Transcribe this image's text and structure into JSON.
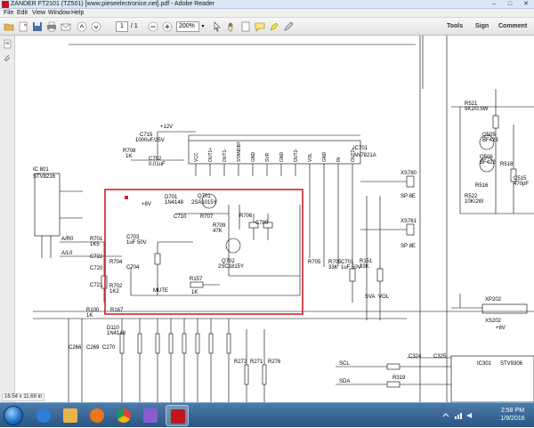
{
  "window": {
    "title": "ZANDER FT2101 (TZ501) [www.pieseelectronice.net].pdf - Adobe Reader",
    "minimize_icon": "minimize-icon",
    "maximize_icon": "maximize-icon",
    "close_icon": "close-icon"
  },
  "menu": [
    "File",
    "Edit",
    "View",
    "Window",
    "Help"
  ],
  "toolbar": {
    "page_current": "1",
    "page_total": "/ 1",
    "zoom": "200%",
    "tools": "Tools",
    "sign": "Sign",
    "comment": "Comment"
  },
  "schematic": {
    "labels": {
      "ic801": "IC 801",
      "stv8216": "STV8216",
      "ic701": "IC701",
      "an7821a": "AN7821A",
      "plus12v": "+12V",
      "c715": "C715",
      "c715v": "1000uF/25V",
      "r708": "R708",
      "r708v": "1K",
      "c702": "C702",
      "c702v": "0.01uF",
      "q701": "Q701",
      "q701v": "2SA1015Y",
      "d701": "D701",
      "d701v": "1N4148",
      "plus8v": "+8V",
      "c710": "C710",
      "r707": "R707",
      "r706": "R706",
      "c709": "C709",
      "q702": "Q702",
      "q702v": "2SC1815Y",
      "r709": "R709",
      "r709v": "47K",
      "c703": "C703",
      "c703v": "1uF 50V",
      "c704": "C704",
      "r704": "R704",
      "r705": "R705",
      "r701": "R701",
      "r701v": "1K5",
      "c722": "C722",
      "c720": "C720",
      "c721": "C721",
      "r702": "R702",
      "r702v": "1K2",
      "mute": "MUTE",
      "r157": "R157",
      "r157v": "1K",
      "r705b": "R705",
      "r705bv": "33K",
      "c701": "C701",
      "c701v": "1uF 50V",
      "r151": "R151",
      "r151v": "33K",
      "sva": "SVA",
      "vol": "VOL",
      "xs760": "XS760",
      "xs761": "XS761",
      "sp8e": "SP 8E",
      "sp8e2": "SP 8E",
      "r521": "R521",
      "r521v": "5K2/0.5W",
      "q505": "Q505",
      "q505v": "BF423",
      "q506": "Q506",
      "q506v": "BF422",
      "r516": "R516",
      "r518": "R518",
      "c515": "C515",
      "c515v": "470pF",
      "r522": "R522",
      "r522v": "10K/2W",
      "xs202": "XS202",
      "xp202": "XP202",
      "plus8v2": "+8V",
      "r100": "R100",
      "r100v": "1K",
      "r167": "R167",
      "d110": "D110",
      "d110v": "1N4148",
      "c266": "C266",
      "c269": "C269",
      "c270": "C270",
      "ic301": "IC301",
      "stv9306": "STV9306",
      "scl": "SCL",
      "sda": "SDA",
      "c324": "C324",
      "c325": "C325",
      "r319": "R319",
      "r271": "R271",
      "r272": "R272",
      "r276": "R276",
      "a_l0": "A/L0",
      "a_r0": "A/R0",
      "pin_labels": [
        "VCC",
        "OUT1+",
        "OUT1-",
        "STANDBY",
        "GND",
        "SVR",
        "GND",
        "OUT2-",
        "VOL",
        "GND",
        "IN",
        "OUT2+"
      ]
    }
  },
  "status": {
    "page_size": "16.54 x 11.69 in"
  },
  "taskbar": {
    "time": "2:58 PM",
    "date": "1/9/2016",
    "apps": [
      {
        "name": "internet-explorer-icon",
        "color": "#2f7fd9"
      },
      {
        "name": "file-explorer-icon",
        "color": "#e8b547"
      },
      {
        "name": "media-player-icon",
        "color": "#e8761c"
      },
      {
        "name": "chrome-icon",
        "color": "#3aa757"
      },
      {
        "name": "paint-icon",
        "color": "#8a5bd1"
      },
      {
        "name": "remote-icon",
        "color": "#2aa0d6"
      },
      {
        "name": "adobe-reader-icon",
        "color": "#c0161b"
      }
    ]
  }
}
